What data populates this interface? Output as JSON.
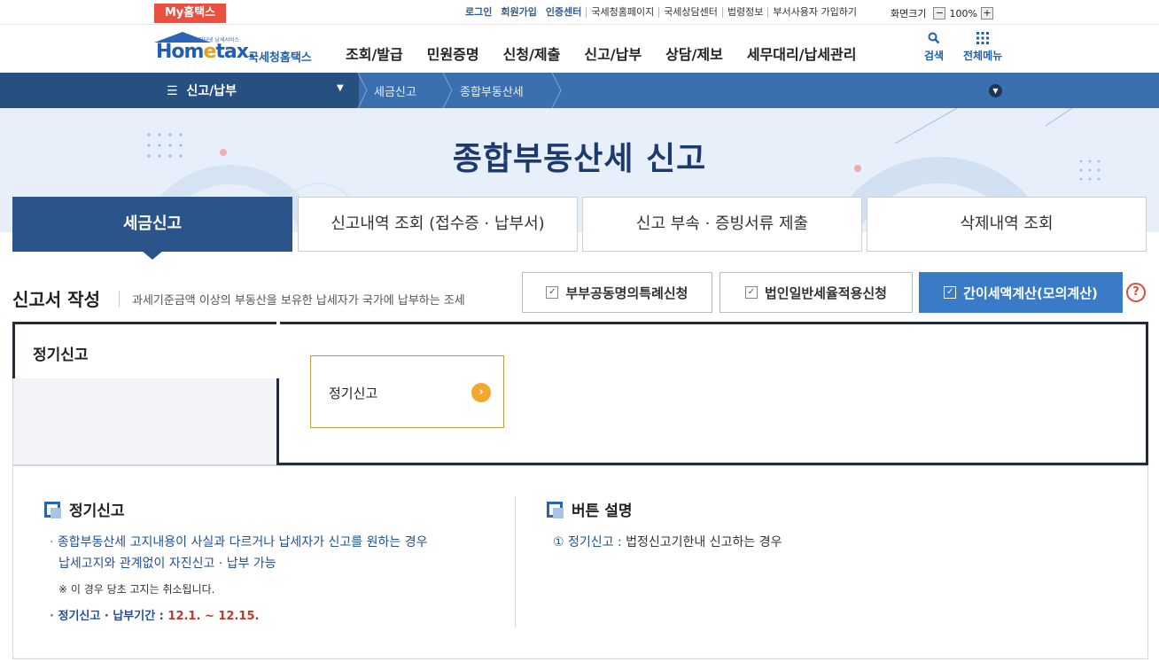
{
  "util": {
    "my_hometax": "My홈택스",
    "links": [
      "로그인",
      "회원가입",
      "인증센터",
      "국세청홈페이지",
      "국세상담센터",
      "법령정보",
      "부서사용자 가입하기"
    ],
    "zoom_label": "화면크기",
    "zoom_minus": "−",
    "zoom_value": "100%",
    "zoom_plus": "+"
  },
  "header": {
    "logo_tiny": "인터넷 납세서비스",
    "logo_home": "Hom",
    "logo_e": "e",
    "logo_tax": "tax.",
    "logo_kor": "국세청홈택스",
    "gnb": [
      "조회/발급",
      "민원증명",
      "신청/제출",
      "신고/납부",
      "상담/제보",
      "세무대리/납세관리"
    ],
    "search_label": "검색",
    "allmenu_label": "전체메뉴"
  },
  "location": {
    "menu": "신고/납부",
    "crumbs": [
      "세금신고",
      "종합부동산세"
    ]
  },
  "hero": {
    "title": "종합부동산세 신고"
  },
  "tabs": [
    "세금신고",
    "신고내역 조회 (접수증 · 납부서)",
    "신고 부속 · 증빙서류 제출",
    "삭제내역 조회"
  ],
  "section": {
    "title": "신고서 작성",
    "desc": "과세기준금액 이상의 부동산을 보유한 납세자가 국가에 납부하는 조세",
    "actions": [
      "부부공동명의특례신청",
      "법인일반세율적용신청",
      "간이세액계산(모의계산)"
    ],
    "help": "?"
  },
  "panel": {
    "tab_label": "정기신고",
    "button_label": "정기신고"
  },
  "info": {
    "left_title": "정기신고",
    "left_line1": "종합부동산세 고지내용이 사실과 다르거나 납세자가 신고를 원하는 경우",
    "left_line2": "납세고지와 관계없이 자진신고 · 납부 가능",
    "left_note": "※ 이 경우 당초 고지는 취소됩니다.",
    "left_period_label": "정기신고 · 납부기간 : ",
    "left_period_value": "12.1. ~ 12.15.",
    "right_title": "버튼 설명",
    "right_line_num": "①",
    "right_line_key": "정기신고 :",
    "right_line_val": "법정신고기한내 신고하는 경우"
  },
  "colors": {
    "brand_blue": "#2a548a",
    "nav_blue": "#3a6fb0",
    "primary_button": "#3a7bc8",
    "accent_orange": "#f2a72d",
    "accent_red": "#c0392b"
  }
}
